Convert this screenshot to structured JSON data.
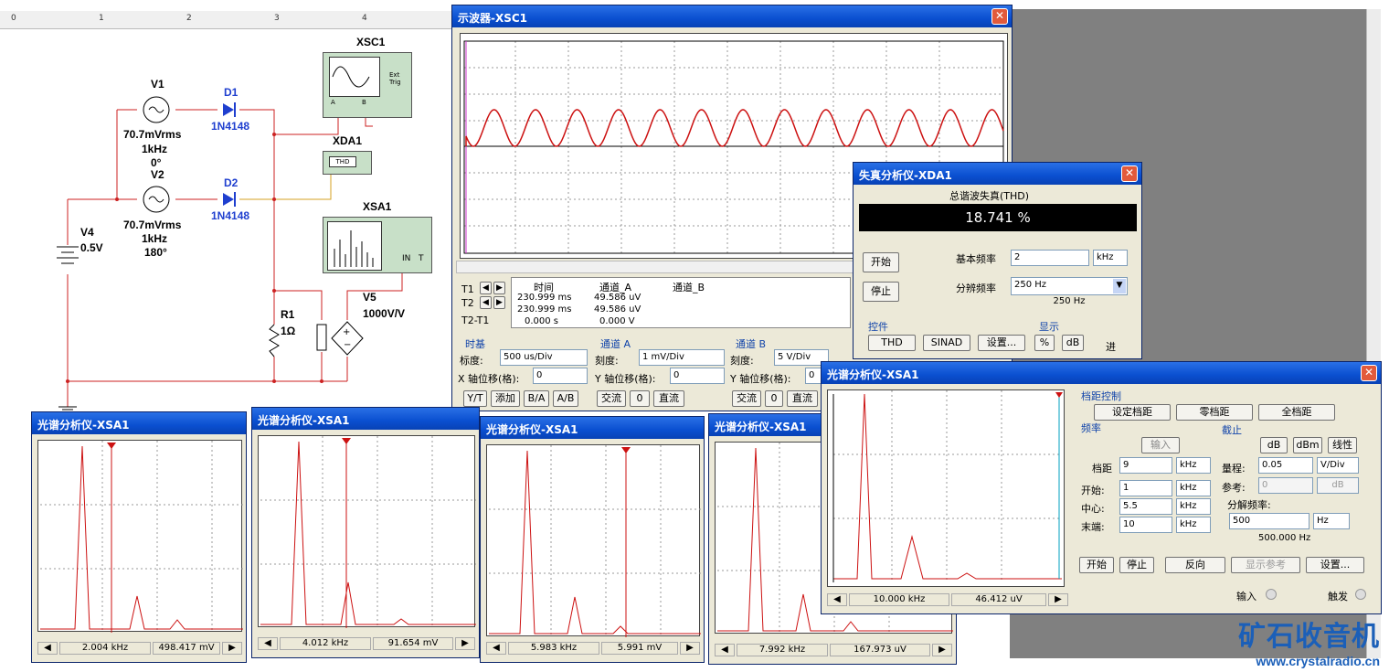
{
  "ruler": [
    "0",
    "1",
    "2",
    "3",
    "4"
  ],
  "schematic": {
    "v1": {
      "name": "V1",
      "line1": "70.7mVrms",
      "line2": "1kHz",
      "line3": "0°"
    },
    "v2": {
      "name": "V2",
      "line1": "70.7mVrms",
      "line2": "1kHz",
      "line3": "180°"
    },
    "v4": {
      "name": "V4",
      "value": "0.5V"
    },
    "v5": {
      "name": "V5",
      "value": "1000V/V"
    },
    "d1": {
      "name": "D1",
      "model": "1N4148"
    },
    "d2": {
      "name": "D2",
      "model": "1N4148"
    },
    "r1": {
      "name": "R1",
      "value": "1Ω"
    },
    "xsc1": "XSC1",
    "xda1": "XDA1",
    "xsa1": "XSA1",
    "xda1_box": "THD",
    "ext_trig": "Ext Trig",
    "a": "A",
    "b": "B",
    "in": "IN",
    "t": "T"
  },
  "oscilloscope": {
    "title": "示波器-XSC1",
    "readout": {
      "headers": [
        "时间",
        "通道_A",
        "通道_B"
      ],
      "t1": {
        "label": "T1",
        "time": "230.999 ms",
        "a": "49.586 uV"
      },
      "t2": {
        "label": "T2",
        "time": "230.999 ms",
        "a": "49.586 uV"
      },
      "dt": {
        "label": "T2-T1",
        "time": "0.000 s",
        "a": "0.000 V"
      }
    },
    "timebase": {
      "title": "时基",
      "scale_label": "标度:",
      "scale": "500 us/Div",
      "xpos_label": "X 轴位移(格):",
      "xpos": "0",
      "buttons": [
        "Y/T",
        "添加",
        "B/A",
        "A/B"
      ]
    },
    "chA": {
      "title": "通道 A",
      "scale_label": "刻度:",
      "scale": "1 mV/Div",
      "ypos_label": "Y 轴位移(格):",
      "ypos": "0",
      "buttons": [
        "交流",
        "0",
        "直流"
      ]
    },
    "chB": {
      "title": "通道 B",
      "scale_label": "刻度:",
      "scale": "5  V/Div",
      "ypos_label": "Y 轴位移(格):",
      "ypos": "0",
      "buttons": [
        "交流",
        "0",
        "直流"
      ]
    }
  },
  "distortion": {
    "title": "失真分析仪-XDA1",
    "heading": "总谐波失真(THD)",
    "value": "18.741 %",
    "start": "开始",
    "stop": "停止",
    "fund_label": "基本频率",
    "fund": "2",
    "fund_unit": "kHz",
    "res_label": "分辨频率",
    "res": "250 Hz",
    "res_display": "250 Hz",
    "controls_title": "控件",
    "display_title": "显示",
    "buttons": [
      "THD",
      "SINAD",
      "设置..."
    ],
    "display_buttons": [
      "%",
      "dB"
    ],
    "in_label": "进"
  },
  "spectrum_small": [
    {
      "title": "光谱分析仪-XSA1",
      "freq": "2.004 kHz",
      "mag": "498.417 mV"
    },
    {
      "title": "光谱分析仪-XSA1",
      "freq": "4.012 kHz",
      "mag": "91.654 mV"
    },
    {
      "title": "光谱分析仪-XSA1",
      "freq": "5.983 kHz",
      "mag": "5.991 mV"
    },
    {
      "title": "光谱分析仪-XSA1",
      "freq": "7.992 kHz",
      "mag": "167.973 uV"
    }
  ],
  "spectrum_main": {
    "title": "光谱分析仪-XSA1",
    "freq": "10.000 kHz",
    "mag": "46.412 uV",
    "span_title": "档距控制",
    "span_buttons": [
      "设定档距",
      "零档距",
      "全档距"
    ],
    "freq_title": "频率",
    "input_btn": "输入",
    "span_label": "档距",
    "span": "9",
    "span_unit": "kHz",
    "start_label": "开始:",
    "start": "1",
    "start_unit": "kHz",
    "center_label": "中心:",
    "center": "5.5",
    "center_unit": "kHz",
    "end_label": "末端:",
    "end": "10",
    "end_unit": "kHz",
    "amp_title": "截止",
    "amp_buttons": [
      "dB",
      "dBm",
      "线性"
    ],
    "range_label": "量程:",
    "range": "0.05",
    "range_unit": "V/Div",
    "ref_label": "参考:",
    "ref": "0",
    "ref_unit": "dB",
    "res_title": "分解频率:",
    "res": "500",
    "res_unit": "Hz",
    "res_display": "500.000 Hz",
    "bottom_buttons": [
      "开始",
      "停止",
      "反向",
      "显示参考",
      "设置..."
    ],
    "input_label": "输入",
    "trigger_label": "触发"
  },
  "watermark": {
    "cn": "矿石收音机",
    "url": "www.crystalradio.cn"
  }
}
